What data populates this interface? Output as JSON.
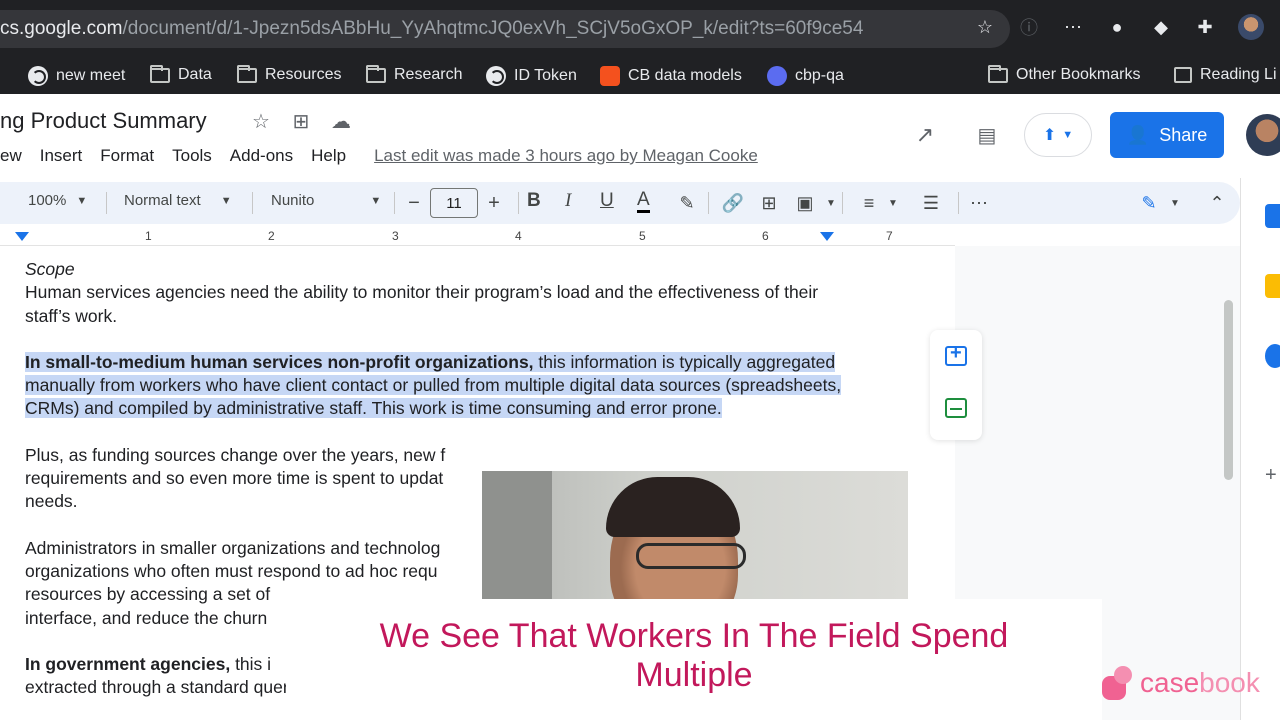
{
  "browser": {
    "url_domain": "cs.google.com",
    "url_path": "/document/d/1-Jpezn5dsABbHu_YyAhqtmcJQ0exVh_SCjV5oGxOP_k/edit?ts=60f9ce54",
    "bookmarks": [
      {
        "label": "new meet",
        "icon": "globe-icon"
      },
      {
        "label": "Data",
        "icon": "folder-icon"
      },
      {
        "label": "Resources",
        "icon": "folder-icon"
      },
      {
        "label": "Research",
        "icon": "folder-icon"
      },
      {
        "label": "ID Token",
        "icon": "globe-icon"
      },
      {
        "label": "CB data models",
        "icon": "app-icon"
      },
      {
        "label": "cbp-qa",
        "icon": "app-icon"
      }
    ],
    "other_bookmarks": "Other Bookmarks",
    "reading_list": "Reading Li"
  },
  "docs": {
    "title": "ng Product Summary",
    "menu": [
      "ew",
      "Insert",
      "Format",
      "Tools",
      "Add-ons",
      "Help"
    ],
    "last_edit": "Last edit was made 3 hours ago by Meagan Cooke",
    "share_label": "Share"
  },
  "toolbar": {
    "zoom": "100%",
    "style": "Normal text",
    "font": "Nunito",
    "font_size": "11"
  },
  "ruler": [
    "1",
    "2",
    "3",
    "4",
    "5",
    "6",
    "7"
  ],
  "document": {
    "scope_heading": "Scope",
    "p1": "Human services agencies need the ability to monitor their program’s load and the effectiveness of their staff’s work.",
    "p2_bold": "In small-to-medium human services non-profit organizations,",
    "p2_rest": " this information is typically aggregated manually from workers who have client contact or pulled from multiple digital data sources (spreadsheets, CRMs) and compiled by administrative staff. This work is time consuming and error prone.",
    "p3_line1": "Plus, as funding sources change over the years, new f",
    "p3_line2": "requirements and so even more time is spent to updat",
    "p3_line3": "needs.",
    "p4_line1": "Administrators in smaller organizations and technolog",
    "p4_line2": "organizations who often must respond to ad hoc requ",
    "p4_line3": "resources by accessing a set of",
    "p4_line4": "interface, and reduce the churn",
    "p5_bold": "In government agencies,",
    "p5_rest": " this i",
    "p5_line2": "extracted through a standard query method that must be developed between practice and"
  },
  "caption": {
    "line1": "We See That Workers In The Field Spend",
    "line2": "Multiple"
  },
  "watermark": {
    "part1": "case",
    "part2": "book"
  },
  "colors": {
    "accent": "#1a73e8",
    "caption": "#c2185b",
    "highlight": "#c6d7f5",
    "brand": "#f06292"
  }
}
